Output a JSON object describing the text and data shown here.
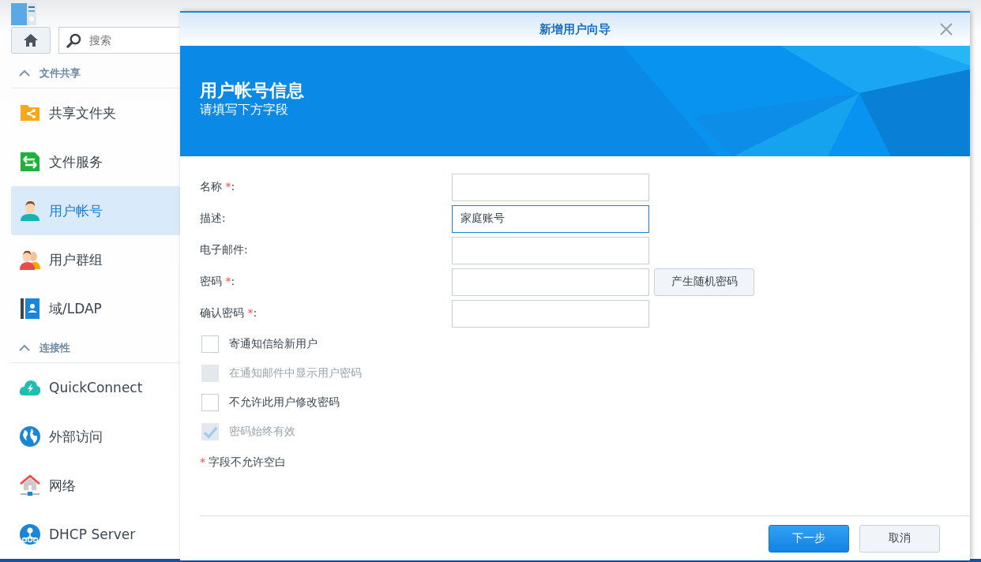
{
  "control_panel": {
    "search": {
      "placeholder": "搜索"
    },
    "sections": [
      {
        "title": "文件共享",
        "expanded": true,
        "items": [
          {
            "label": "共享文件夹",
            "kind": "share-folder",
            "selected": false
          },
          {
            "label": "文件服务",
            "kind": "file-services",
            "selected": false
          },
          {
            "label": "用户帐号",
            "kind": "user",
            "selected": true
          },
          {
            "label": "用户群组",
            "kind": "group",
            "selected": false
          },
          {
            "label": "域/LDAP",
            "kind": "ldap",
            "selected": false
          }
        ]
      },
      {
        "title": "连接性",
        "expanded": true,
        "items": [
          {
            "label": "QuickConnect",
            "kind": "quickconnect",
            "selected": false
          },
          {
            "label": "外部访问",
            "kind": "globe",
            "selected": false
          },
          {
            "label": "网络",
            "kind": "network",
            "selected": false
          },
          {
            "label": "DHCP Server",
            "kind": "dhcp",
            "selected": false
          }
        ]
      }
    ]
  },
  "dialog": {
    "title": "新增用户向导",
    "banner": {
      "title": "用户帐号信息",
      "subtitle": "请填写下方字段"
    },
    "fields": [
      {
        "label": "名称",
        "required_mark": "*",
        "label_end": ":",
        "focused": false
      },
      {
        "label": "描述:",
        "value": "家庭账号",
        "focused": true
      },
      {
        "label": "电子邮件:",
        "focused": false
      },
      {
        "label": "密码",
        "required_mark": "*",
        "label_end": ":",
        "focused": false,
        "button": "产生随机密码"
      },
      {
        "label": "确认密码",
        "required_mark": "*",
        "label_end": ":",
        "focused": false
      }
    ],
    "checkboxes": [
      {
        "label": "寄通知信给新用户",
        "checked": false,
        "disabled": false
      },
      {
        "label": "在通知邮件中显示用户密码",
        "checked": false,
        "disabled": true
      },
      {
        "label": "不允许此用户修改密码",
        "checked": false,
        "disabled": false
      },
      {
        "label": "密码始终有效",
        "checked": true,
        "disabled": true
      }
    ],
    "required_note": {
      "mark": "*",
      "text": "字段不允许空白"
    },
    "buttons": [
      {
        "label": "下一步",
        "kind": "primary"
      },
      {
        "label": "取消",
        "kind": "secondary"
      }
    ]
  }
}
